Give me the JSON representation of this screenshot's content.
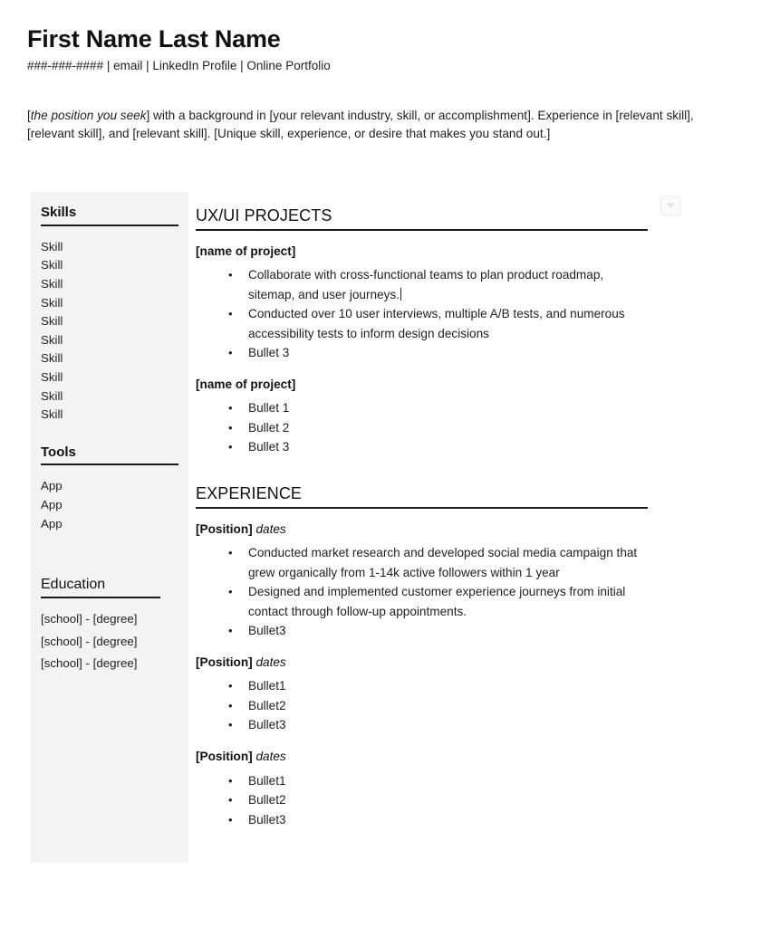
{
  "header": {
    "name": "First Name Last Name",
    "contact": "###-###-#### | email | LinkedIn Profile | Online Portfolio"
  },
  "summary": {
    "position_placeholder": "the position you seek",
    "before": "[",
    "after_position": "]  with a background in  [your relevant industry, skill, or accomplishment]. Experience in [relevant skill], [relevant skill], and [relevant skill]. [Unique skill, experience, or desire that makes you stand out.]"
  },
  "sidebar": {
    "skills": {
      "heading": "Skills",
      "items": [
        "Skill",
        "Skill",
        "Skill",
        "Skill",
        "Skill",
        "Skill",
        "Skill",
        "Skill",
        "Skill",
        "Skill"
      ]
    },
    "tools": {
      "heading": "Tools",
      "items": [
        "App",
        "App",
        "App"
      ]
    },
    "education": {
      "heading": "Education",
      "items": [
        "[school] - [degree]",
        "[school] - [degree]",
        "[school] - [degree]"
      ]
    }
  },
  "main": {
    "projects": {
      "heading": "UX/UI PROJECTS",
      "entries": [
        {
          "title": "[name of project]",
          "dates": "",
          "bullets": [
            "Collaborate with cross-functional teams to plan product roadmap, sitemap, and user journeys.",
            "Conducted over 10 user interviews, multiple A/B tests, and numerous accessibility tests to inform design decisions",
            "Bullet 3"
          ]
        },
        {
          "title": "[name of project]",
          "dates": "",
          "bullets": [
            "Bullet 1",
            "Bullet 2",
            "Bullet 3"
          ]
        }
      ]
    },
    "experience": {
      "heading": "EXPERIENCE",
      "entries": [
        {
          "title": "[Position]",
          "dates": "dates",
          "bullets": [
            "Conducted market research and developed social media campaign that grew organically from 1-14k active followers within 1 year",
            "Designed and implemented customer experience journeys from initial contact through follow-up appointments.",
            "Bullet3"
          ]
        },
        {
          "title": "[Position]",
          "dates": "dates",
          "bullets": [
            "Bullet1",
            "Bullet2",
            "Bullet3"
          ]
        },
        {
          "title": "[Position]",
          "dates": "dates",
          "bullets": [
            "Bullet1",
            "Bullet2",
            "Bullet3"
          ]
        }
      ]
    }
  },
  "widgets": {
    "dropdown_icon": "chevron-down-icon"
  },
  "colors": {
    "sidebar_bg": "#f3f3f3",
    "rule": "#1a1a1a",
    "text": "#1f1f1f"
  }
}
